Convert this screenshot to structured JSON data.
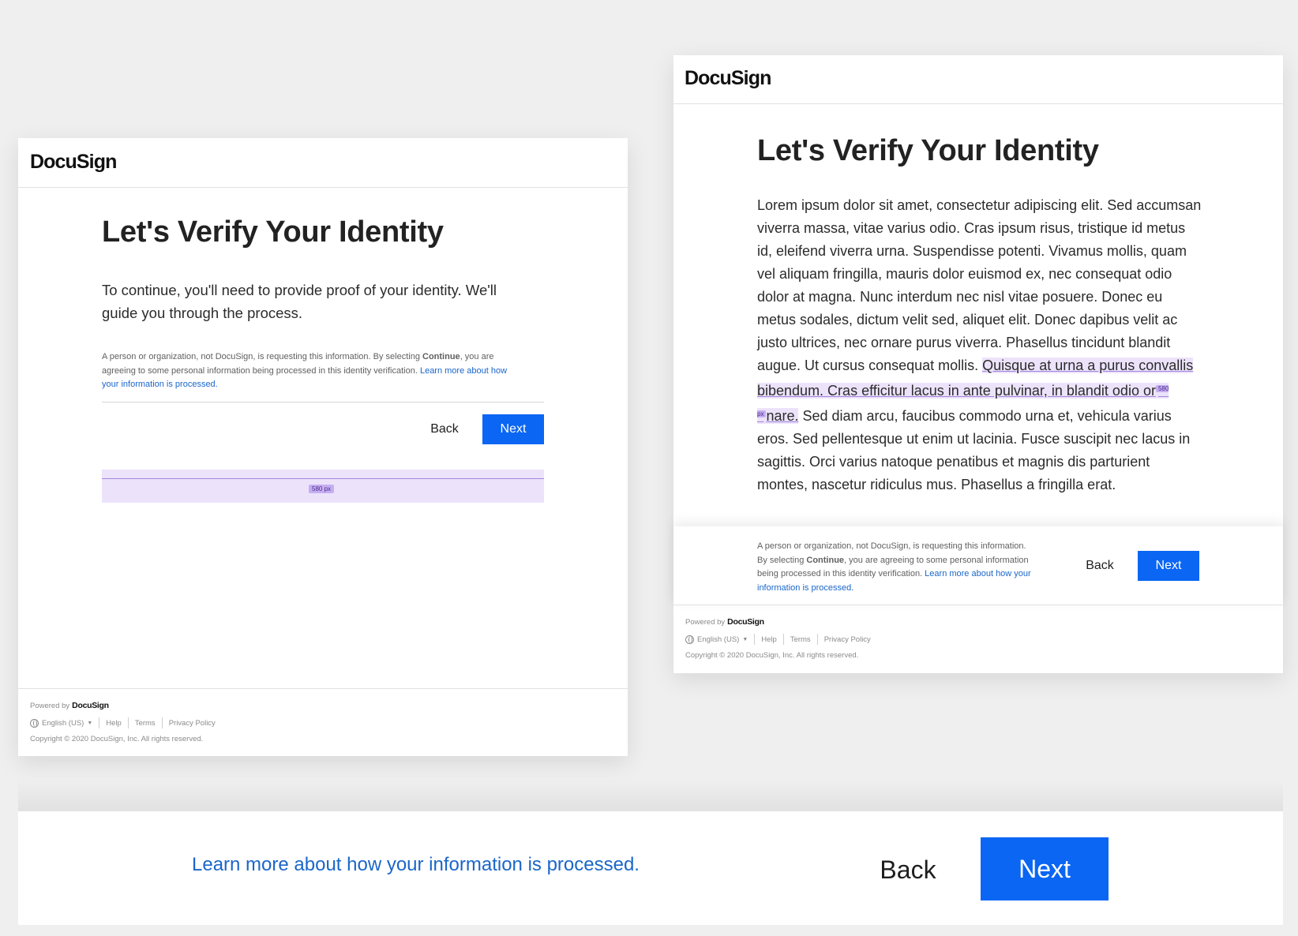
{
  "brand": {
    "name": "DocuSign",
    "accent_color": "#0a66f3",
    "link_color": "#1b66c9"
  },
  "left_card": {
    "title": "Let's Verify Your Identity",
    "lead": "To continue, you'll need to provide proof of your identity. We'll guide you through the process.",
    "disclaimer_pre": "A person or organization, not DocuSign, is requesting this information. By selecting ",
    "disclaimer_bold": "Continue",
    "disclaimer_post": ", you are agreeing to some personal information being processed in this identity verification. ",
    "learn_more_link": "Learn more about how your information is processed.",
    "back_label": "Back",
    "next_label": "Next",
    "measure_label": "580 px"
  },
  "right_card": {
    "title": "Let's Verify Your Identity",
    "body_before": "Lorem ipsum dolor sit amet, consectetur adipiscing elit. Sed accumsan viverra massa, vitae varius odio. Cras ipsum risus, tristique id metus id, eleifend viverra urna. Suspendisse potenti. Vivamus mollis, quam vel aliquam fringilla, mauris dolor euismod ex, nec consequat odio dolor at magna. Nunc interdum nec nisl vitae posuere. Donec eu metus sodales, dictum velit sed, aliquet elit. Donec dapibus velit ac justo ultrices, nec ornare purus viverra. Phasellus tincidunt blandit augue. Ut cursus consequat mollis. ",
    "body_highlight_a": "Quisque at urna a purus convallis bibendum. Cras efficitur lacus in ante pulvinar, in blandit odio or",
    "body_highlight_b": "nare.",
    "body_after": " Sed diam arcu, faucibus commodo urna et, vehicula varius eros. Sed pellentesque ut enim ut lacinia. Fusce suscipit nec lacus in sagittis. Orci varius natoque penatibus et magnis dis parturient montes, nascetur ridiculus mus. Phasellus a fringilla erat.",
    "measure_label": "580 px",
    "disclaimer_pre": "A person or organization, not DocuSign, is requesting this information. By selecting ",
    "disclaimer_bold": "Continue",
    "disclaimer_post": ", you are agreeing to some personal information being processed in this identity verification. ",
    "learn_more_link": "Learn more about how your information is processed.",
    "back_label": "Back",
    "next_label": "Next"
  },
  "footer": {
    "powered_by": "Powered by",
    "powered_logo": "DocuSign",
    "language": "English (US)",
    "help": "Help",
    "terms": "Terms",
    "privacy": "Privacy Policy",
    "copyright": "Copyright © 2020 DocuSign, Inc. All rights reserved."
  },
  "zoom_panel": {
    "learn_more_link": "Learn more about how your information is processed.",
    "back_label": "Back",
    "next_label": "Next"
  }
}
